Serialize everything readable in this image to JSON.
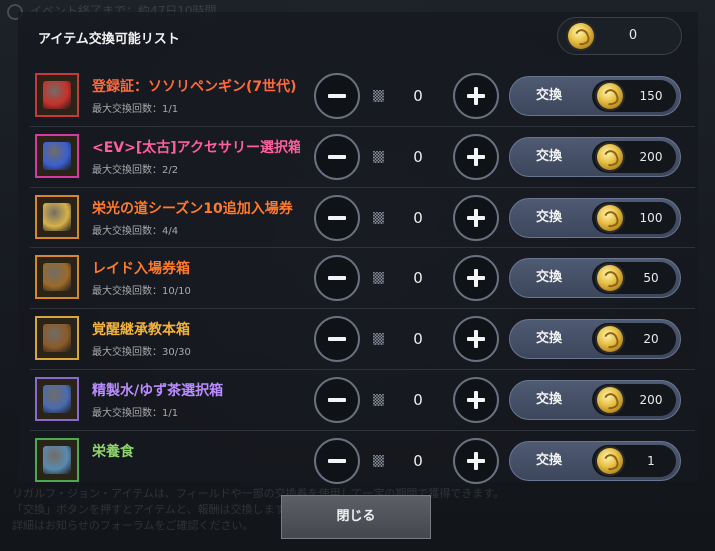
{
  "header": {
    "faded_event_text": "イベント終了まで：約47日10時間",
    "list_title": "アイテム交換可能リスト",
    "currency_total": "0"
  },
  "footer": {
    "faded_lines": [
      "リガルフ・ジョン・アイテムは、フィールドや一部の交換券を使用して一定の期間で獲得できます。",
      "「交換」ボタンを押すとアイテムと、報酬は交換します。",
      "詳細はお知らせのフォーラムをご確認ください。"
    ]
  },
  "rows": [
    {
      "name": "登録証：ソソリペンギン(7世代)",
      "name_color": "#ff6a3c",
      "limit": "最大交換回数：1/1",
      "qty": "0",
      "exchange_label": "交換",
      "cost": "150",
      "icon": "penguin-card-icon",
      "icon_color": "#c7312a",
      "border": "#c83a3a"
    },
    {
      "name": "<EV>[太古]アクセサリー選択箱",
      "name_color": "#ff5fa0",
      "limit": "最大交換回数：2/2",
      "qty": "0",
      "exchange_label": "交換",
      "cost": "200",
      "icon": "accessory-box-icon",
      "icon_color": "#3c5fd0",
      "border": "#d63aa0"
    },
    {
      "name": "栄光の道シーズン10追加入場券",
      "name_color": "#ff7a2a",
      "limit": "最大交換回数：4/4",
      "qty": "0",
      "exchange_label": "交換",
      "cost": "100",
      "icon": "ticket-icon",
      "icon_color": "#d6b24a",
      "border": "#d9862a"
    },
    {
      "name": "レイド入場券箱",
      "name_color": "#ff7a2a",
      "limit": "最大交換回数：10/10",
      "qty": "0",
      "exchange_label": "交換",
      "cost": "50",
      "icon": "treasure-chest-icon",
      "icon_color": "#9a6a2a",
      "border": "#d9862a"
    },
    {
      "name": "覚醒継承教本箱",
      "name_color": "#f2b23a",
      "limit": "最大交換回数：30/30",
      "qty": "0",
      "exchange_label": "交換",
      "cost": "20",
      "icon": "tome-chest-icon",
      "icon_color": "#8a5a2a",
      "border": "#d9a53a"
    },
    {
      "name": "精製水/ゆず茶選択箱",
      "name_color": "#b98cff",
      "limit": "最大交換回数：1/1",
      "qty": "0",
      "exchange_label": "交換",
      "cost": "200",
      "icon": "potion-box-icon",
      "icon_color": "#4a6ab0",
      "border": "#8a6ad0"
    },
    {
      "name": "栄養食",
      "name_color": "#8fd46a",
      "limit": "",
      "qty": "0",
      "exchange_label": "交換",
      "cost": "1",
      "icon": "food-bowl-icon",
      "icon_color": "#5a8ab0",
      "border": "#4caa4c"
    }
  ],
  "close_label": "閉じる"
}
